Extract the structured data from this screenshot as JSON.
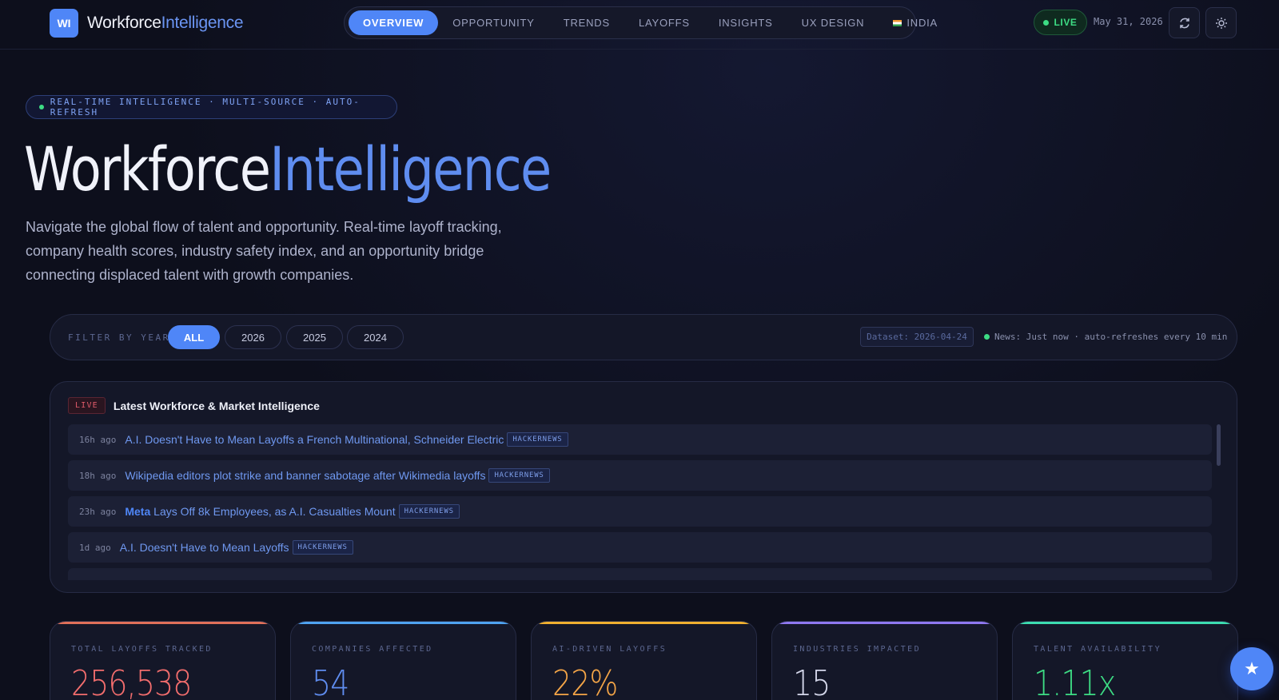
{
  "header": {
    "logo_text": "WI",
    "brand_main": "Workforce",
    "brand_accent": "Intelligence",
    "nav": [
      "OVERVIEW",
      "OPPORTUNITY",
      "TRENDS",
      "LAYOFFS",
      "INSIGHTS",
      "UX DESIGN",
      "INDIA"
    ],
    "active_nav": "OVERVIEW",
    "live_label": "LIVE",
    "date": "May 31, 2026",
    "refresh_icon": "refresh-icon",
    "theme_icon": "sun-icon"
  },
  "hero": {
    "tagline": "REAL-TIME INTELLIGENCE · MULTI-SOURCE · AUTO-REFRESH",
    "title_main": "Workforce",
    "title_accent": "Intelligence",
    "description": "Navigate the global flow of talent and opportunity. Real-time layoff tracking, company health scores, industry safety index, and an opportunity bridge connecting displaced talent with growth companies."
  },
  "filter": {
    "label": "FILTER BY YEAR",
    "years": [
      "ALL",
      "2026",
      "2025",
      "2024"
    ],
    "active_year": "ALL",
    "dataset": "Dataset: 2026-04-24",
    "news_status": "News: Just now · auto-refreshes every 10 min"
  },
  "news": {
    "live_tag": "LIVE",
    "title": "Latest Workforce & Market Intelligence",
    "items": [
      {
        "time": "16h ago",
        "highlight": "",
        "headline": "A.I. Doesn't Have to Mean Layoffs a French Multinational, Schneider Electric",
        "source": "HACKERNEWS"
      },
      {
        "time": "18h ago",
        "highlight": "",
        "headline": "Wikipedia editors plot strike and banner sabotage after Wikimedia layoffs",
        "source": "HACKERNEWS"
      },
      {
        "time": "23h ago",
        "highlight": "Meta",
        "headline": " Lays Off 8k Employees, as A.I. Casualties Mount",
        "source": "HACKERNEWS"
      },
      {
        "time": "1d ago",
        "highlight": "",
        "headline": "A.I. Doesn't Have to Mean Layoffs",
        "source": "HACKERNEWS"
      }
    ]
  },
  "stats": [
    {
      "label": "TOTAL LAYOFFS TRACKED",
      "value": "256,538",
      "color": "#f26d6d",
      "accent": "#e0705a"
    },
    {
      "label": "COMPANIES AFFECTED",
      "value": "54",
      "color": "#5f8df0",
      "accent": "#4fa3f0"
    },
    {
      "label": "AI-DRIVEN LAYOFFS",
      "value": "22%",
      "color": "#f4a547",
      "accent": "#f0b030"
    },
    {
      "label": "INDUSTRIES IMPACTED",
      "value": "15",
      "color": "#d4d7ea",
      "accent": "#8f78f0"
    },
    {
      "label": "TALENT AVAILABILITY",
      "value": "1.11x",
      "color": "#3ddc84",
      "accent": "#3ddcb0"
    }
  ],
  "fab_icon": "star-icon"
}
